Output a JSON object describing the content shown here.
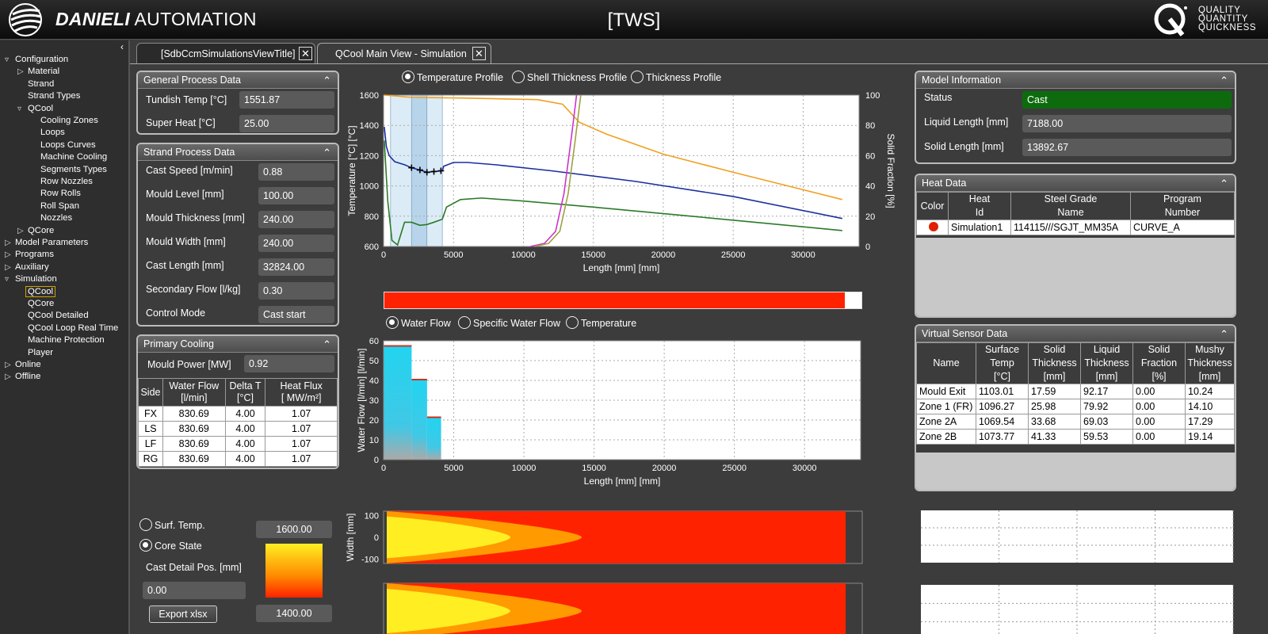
{
  "header": {
    "brand_bold": "DANIELI",
    "brand_rest": " AUTOMATION",
    "title": "[TWS]",
    "tagline": [
      "QUALITY",
      "QUANTITY",
      "QUICKNESS"
    ]
  },
  "sidebar": {
    "collapse_glyph": "‹",
    "items": [
      {
        "label": "Configuration",
        "level": 0,
        "expander": "▿"
      },
      {
        "label": "Material",
        "level": 1,
        "expander": "▷"
      },
      {
        "label": "Strand",
        "level": 1,
        "expander": ""
      },
      {
        "label": "Strand Types",
        "level": 1,
        "expander": ""
      },
      {
        "label": "QCool",
        "level": 1,
        "expander": "▿"
      },
      {
        "label": "Cooling Zones",
        "level": 2,
        "expander": ""
      },
      {
        "label": "Loops",
        "level": 2,
        "expander": ""
      },
      {
        "label": "Loops Curves",
        "level": 2,
        "expander": ""
      },
      {
        "label": "Machine Cooling",
        "level": 2,
        "expander": ""
      },
      {
        "label": "Segments Types",
        "level": 2,
        "expander": ""
      },
      {
        "label": "Row Nozzles",
        "level": 2,
        "expander": ""
      },
      {
        "label": "Row Rolls",
        "level": 2,
        "expander": ""
      },
      {
        "label": "Roll Span",
        "level": 2,
        "expander": ""
      },
      {
        "label": "Nozzles",
        "level": 2,
        "expander": ""
      },
      {
        "label": "QCore",
        "level": 1,
        "expander": "▷"
      },
      {
        "label": "Model Parameters",
        "level": 0,
        "expander": "▷"
      },
      {
        "label": "Programs",
        "level": 0,
        "expander": "▷"
      },
      {
        "label": "Auxiliary",
        "level": 0,
        "expander": "▷"
      },
      {
        "label": "Simulation",
        "level": 0,
        "expander": "▿"
      },
      {
        "label": "QCool",
        "level": 1,
        "expander": "",
        "selected": true
      },
      {
        "label": "QCore",
        "level": 1,
        "expander": ""
      },
      {
        "label": "QCool Detailed",
        "level": 1,
        "expander": ""
      },
      {
        "label": "QCool Loop Real Time",
        "level": 1,
        "expander": ""
      },
      {
        "label": "Machine Protection",
        "level": 1,
        "expander": ""
      },
      {
        "label": "Player",
        "level": 1,
        "expander": ""
      },
      {
        "label": "Online",
        "level": 0,
        "expander": "▷"
      },
      {
        "label": "Offline",
        "level": 0,
        "expander": "▷"
      }
    ]
  },
  "tabs": [
    {
      "label": "[SdbCcmSimulationsViewTitle]",
      "close": "✕",
      "active": false
    },
    {
      "label": "QCool Main View - Simulation",
      "close": "✕",
      "active": true
    }
  ],
  "general": {
    "title": "General Process Data",
    "chevron": "⌃",
    "fields": [
      {
        "label": "Tundish Temp [°C]",
        "value": "1551.87"
      },
      {
        "label": "Super Heat [°C]",
        "value": "25.00"
      }
    ]
  },
  "strand": {
    "title": "Strand Process Data",
    "chevron": "⌃",
    "fields": [
      {
        "label": "Cast Speed [m/min]",
        "value": "0.88"
      },
      {
        "label": "Mould Level [mm]",
        "value": "100.00"
      },
      {
        "label": "Mould Thickness [mm]",
        "value": "240.00"
      },
      {
        "label": "Mould Width [mm]",
        "value": "240.00"
      },
      {
        "label": "Cast Length [mm]",
        "value": "32824.00"
      },
      {
        "label": "Secondary Flow [l/kg]",
        "value": "0.30"
      },
      {
        "label": "Control Mode",
        "value": "Cast start"
      }
    ]
  },
  "primary": {
    "title": "Primary Cooling",
    "chevron": "⌃",
    "mould_power_label": "Mould Power [MW]",
    "mould_power": "0.92",
    "headers": [
      "Side",
      "Water Flow\n[l/min]",
      "Delta T\n[°C]",
      "Heat Flux\n[ MW/m²]"
    ],
    "rows": [
      [
        "FX",
        "830.69",
        "4.00",
        "1.07"
      ],
      [
        "LS",
        "830.69",
        "4.00",
        "1.07"
      ],
      [
        "LF",
        "830.69",
        "4.00",
        "1.07"
      ],
      [
        "RG",
        "830.69",
        "4.00",
        "1.07"
      ]
    ]
  },
  "core": {
    "radio1": "Surf. Temp.",
    "radio2": "Core State",
    "radio_selected": 2,
    "pos_label": "Cast Detail Pos. [mm]",
    "pos_value": "0.00",
    "export_label": "Export xlsx",
    "scale_max": "1600.00",
    "scale_min": "1400.00",
    "gradient": [
      "#ffee22",
      "#ff8a00",
      "#ff2200"
    ]
  },
  "profile_radios": {
    "options": [
      "Temperature Profile",
      "Shell Thickness Profile",
      "Thickness Profile"
    ],
    "selected": 0
  },
  "flow_radios": {
    "options": [
      "Water Flow",
      "Specific Water Flow",
      "Temperature"
    ],
    "selected": 0
  },
  "progress": {
    "fraction": 0.965,
    "color": "#ff2200"
  },
  "model": {
    "title": "Model Information",
    "chevron": "⌃",
    "fields": [
      {
        "label": "Status",
        "value": "Cast",
        "status": true
      },
      {
        "label": "Liquid Length [mm]",
        "value": "7188.00"
      },
      {
        "label": "Solid Length [mm]",
        "value": "13892.67"
      }
    ]
  },
  "heat": {
    "title": "Heat Data",
    "chevron": "⌃",
    "headers": [
      "Color",
      "Heat\nId",
      "Steel Grade\nName",
      "Program\nNumber"
    ],
    "rows": [
      {
        "color": "#e02000",
        "id": "Simulation1",
        "grade": "114115///SGJT_MM35A",
        "program": "CURVE_A"
      }
    ]
  },
  "sensor": {
    "title": "Virtual Sensor Data",
    "chevron": "⌃",
    "headers": [
      "Name",
      "Surface\nTemp\n[°C]",
      "Solid\nThickness\n[mm]",
      "Liquid\nThickness\n[mm]",
      "Solid\nFraction\n[%]",
      "Mushy\nThickness\n[mm]"
    ],
    "rows": [
      [
        "Mould Exit",
        "1103.01",
        "17.59",
        "92.17",
        "0.00",
        "10.24"
      ],
      [
        "Zone 1 (FR)",
        "1096.27",
        "25.98",
        "79.92",
        "0.00",
        "14.10"
      ],
      [
        "Zone 2A",
        "1069.54",
        "33.68",
        "69.03",
        "0.00",
        "17.29"
      ],
      [
        "Zone 2B",
        "1073.77",
        "41.33",
        "59.53",
        "0.00",
        "19.14"
      ]
    ]
  },
  "chart_data": [
    {
      "type": "line",
      "xlabel": "Length [mm] [mm]",
      "ylabel": "Temperature [°C] [°C]",
      "y2label": "Solid Fraction [%]",
      "xlim": [
        0,
        34000
      ],
      "ylim": [
        600,
        1600
      ],
      "y2lim": [
        0,
        100
      ],
      "xticks": [
        0,
        5000,
        10000,
        15000,
        20000,
        25000,
        30000
      ],
      "yticks": [
        600,
        800,
        1000,
        1200,
        1400,
        1600
      ],
      "y2ticks": [
        0,
        20,
        40,
        60,
        80,
        100
      ],
      "grid": true,
      "zones": [
        [
          500,
          2000
        ],
        [
          2000,
          3100
        ],
        [
          3100,
          4200
        ]
      ],
      "series": [
        {
          "color": "#1a2fa0",
          "axis": "y",
          "points": [
            [
              50,
              1390
            ],
            [
              200,
              1260
            ],
            [
              400,
              1200
            ],
            [
              800,
              1160
            ],
            [
              1500,
              1140
            ],
            [
              2000,
              1120
            ],
            [
              2600,
              1105
            ],
            [
              3100,
              1090
            ],
            [
              3600,
              1095
            ],
            [
              4200,
              1100
            ],
            [
              4300,
              1130
            ],
            [
              5000,
              1155
            ],
            [
              6000,
              1155
            ],
            [
              8000,
              1140
            ],
            [
              12000,
              1100
            ],
            [
              18000,
              1030
            ],
            [
              25000,
              930
            ],
            [
              32800,
              785
            ]
          ]
        },
        {
          "color": "#2a7a2a",
          "axis": "y",
          "points": [
            [
              50,
              1300
            ],
            [
              300,
              900
            ],
            [
              600,
              640
            ],
            [
              1000,
              610
            ],
            [
              1300,
              700
            ],
            [
              1500,
              760
            ],
            [
              2000,
              760
            ],
            [
              2600,
              740
            ],
            [
              3100,
              745
            ],
            [
              3600,
              760
            ],
            [
              4200,
              780
            ],
            [
              4500,
              860
            ],
            [
              5500,
              910
            ],
            [
              7000,
              920
            ],
            [
              10000,
              900
            ],
            [
              15000,
              860
            ],
            [
              22000,
              800
            ],
            [
              32800,
              705
            ]
          ]
        },
        {
          "color": "#f0a020",
          "axis": "y",
          "points": [
            [
              50,
              1600
            ],
            [
              2000,
              1585
            ],
            [
              6000,
              1580
            ],
            [
              11000,
              1570
            ],
            [
              12800,
              1540
            ],
            [
              14000,
              1420
            ],
            [
              16000,
              1340
            ],
            [
              20000,
              1210
            ],
            [
              25000,
              1090
            ],
            [
              32800,
              910
            ]
          ]
        },
        {
          "color": "#cc33cc",
          "axis": "y2",
          "points": [
            [
              10500,
              0
            ],
            [
              11500,
              2
            ],
            [
              12300,
              10
            ],
            [
              12900,
              35
            ],
            [
              13400,
              70
            ],
            [
              13800,
              100
            ]
          ]
        },
        {
          "color": "#a0a040",
          "axis": "y2",
          "points": [
            [
              10800,
              0
            ],
            [
              11800,
              2
            ],
            [
              12600,
              10
            ],
            [
              13200,
              35
            ],
            [
              13700,
              70
            ],
            [
              14100,
              100
            ]
          ]
        }
      ],
      "markers": [
        [
          2000,
          1120
        ],
        [
          2600,
          1105
        ],
        [
          3100,
          1090
        ],
        [
          3600,
          1095
        ],
        [
          4100,
          1100
        ]
      ]
    },
    {
      "type": "bar",
      "xlabel": "Length [mm] [mm]",
      "ylabel": "Water Flow [l/min] [l/min]",
      "xlim": [
        0,
        34000
      ],
      "ylim": [
        0,
        60
      ],
      "xticks": [
        0,
        5000,
        10000,
        15000,
        20000,
        25000,
        30000
      ],
      "yticks": [
        0,
        10,
        20,
        30,
        40,
        50,
        60
      ],
      "grid": true,
      "bars": [
        {
          "x0": 0,
          "x1": 2000,
          "value": 57
        },
        {
          "x0": 2000,
          "x1": 3100,
          "value": 40
        },
        {
          "x0": 3100,
          "x1": 4100,
          "value": 21
        }
      ]
    },
    {
      "type": "heatmap",
      "ylabel": "Width [mm]",
      "ylim": [
        -120,
        120
      ],
      "yticks": [
        100,
        0,
        -100
      ],
      "colors": [
        "#ff2200",
        "#ff9a00",
        "#ffee22"
      ],
      "x_extent": [
        0,
        32824
      ]
    }
  ]
}
